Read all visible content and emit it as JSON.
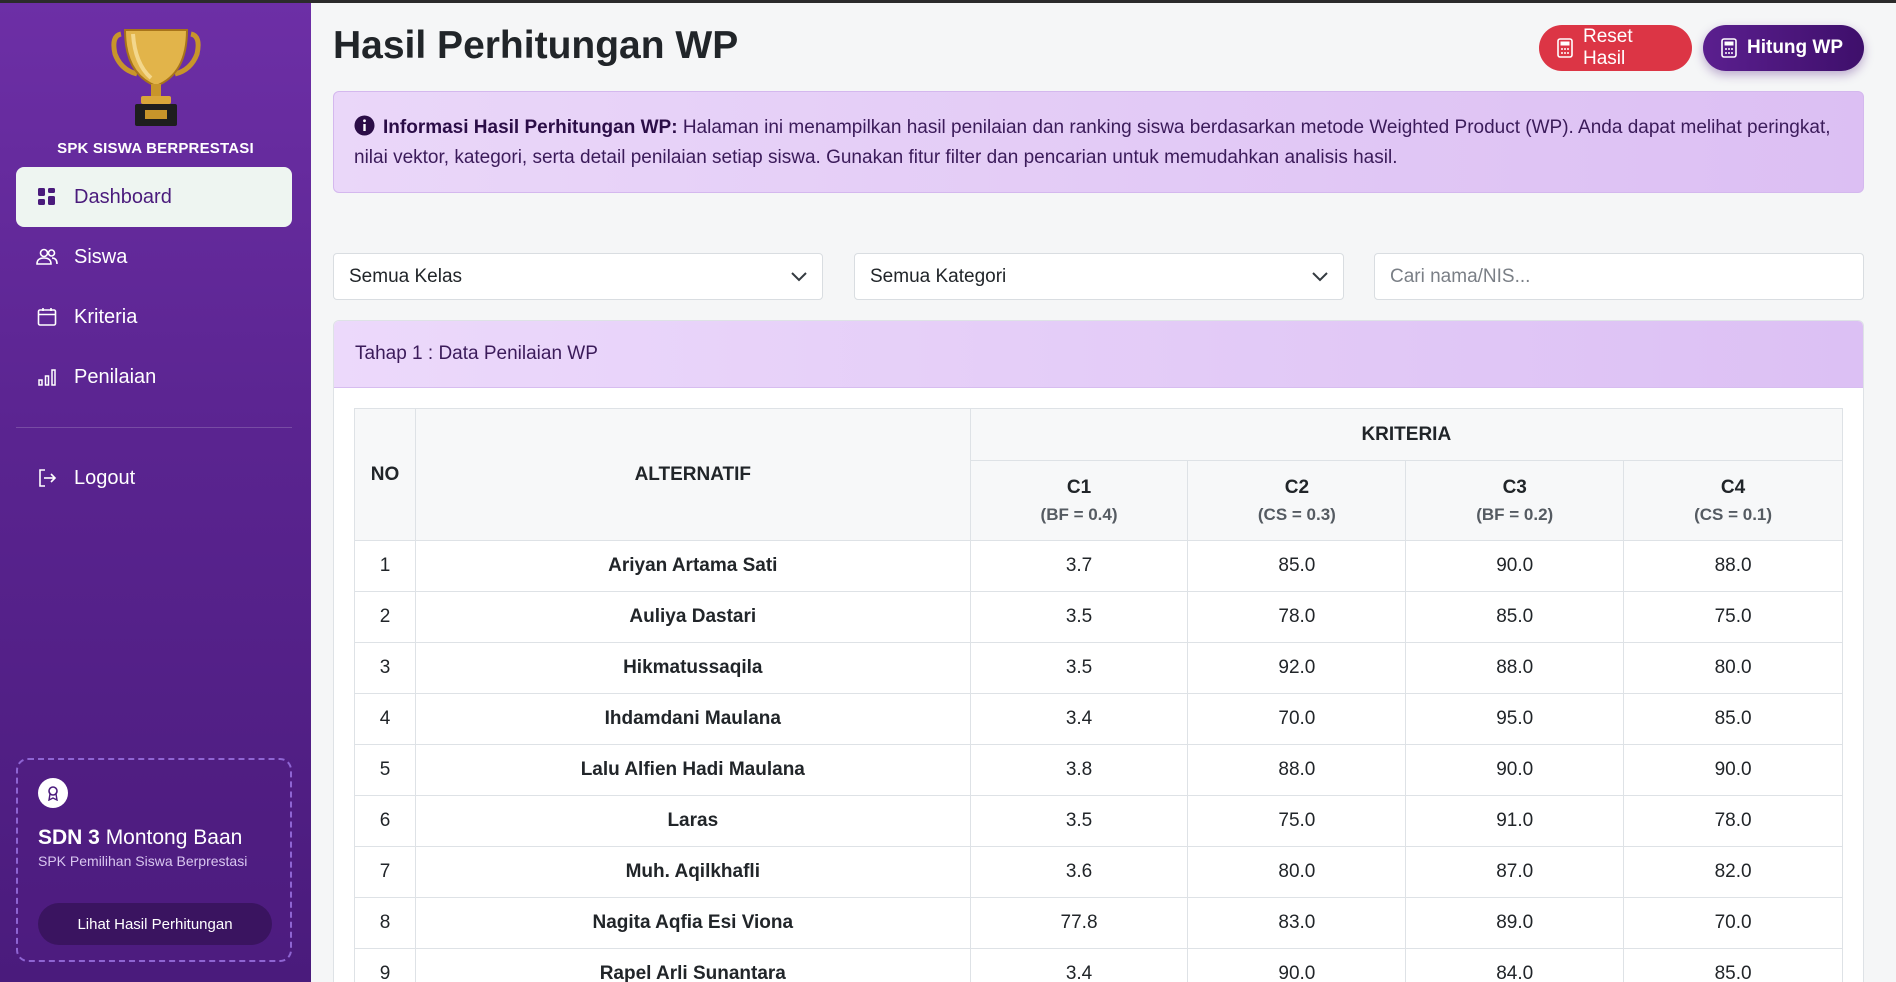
{
  "sidebar": {
    "brand": "SPK SISWA BERPRESTASI",
    "items": [
      {
        "label": "Dashboard",
        "icon": "dashboard-icon",
        "active": true
      },
      {
        "label": "Siswa",
        "icon": "users-icon"
      },
      {
        "label": "Kriteria",
        "icon": "calendar-icon"
      },
      {
        "label": "Penilaian",
        "icon": "chart-icon"
      }
    ],
    "logout": "Logout",
    "school": {
      "name_bold": "SDN 3",
      "name_rest": " Montong Baan",
      "subtitle": "SPK Pemilihan Siswa Berprestasi",
      "button": "Lihat Hasil Perhitungan"
    }
  },
  "header": {
    "title": "Hasil Perhitungan WP",
    "reset_label": "Reset Hasil",
    "hitung_label": "Hitung WP"
  },
  "info": {
    "heading": "Informasi Hasil Perhitungan WP:",
    "text": " Halaman ini menampilkan hasil penilaian dan ranking siswa berdasarkan metode Weighted Product (WP). Anda dapat melihat peringkat, nilai vektor, kategori, serta detail penilaian setiap siswa. Gunakan fitur filter dan pencarian untuk memudahkan analisis hasil."
  },
  "filters": {
    "kelas": "Semua Kelas",
    "kategori": "Semua Kategori",
    "search_placeholder": "Cari nama/NIS..."
  },
  "table": {
    "card_title": "Tahap 1 : Data Penilaian WP",
    "col_no": "NO",
    "col_alternatif": "ALTERNATIF",
    "col_kriteria": "KRITERIA",
    "criteria": [
      {
        "code": "C1",
        "sub": "(BF = 0.4)"
      },
      {
        "code": "C2",
        "sub": "(CS = 0.3)"
      },
      {
        "code": "C3",
        "sub": "(BF = 0.2)"
      },
      {
        "code": "C4",
        "sub": "(CS = 0.1)"
      }
    ],
    "rows": [
      [
        "1",
        "Ariyan Artama Sati",
        "3.7",
        "85.0",
        "90.0",
        "88.0"
      ],
      [
        "2",
        "Auliya Dastari",
        "3.5",
        "78.0",
        "85.0",
        "75.0"
      ],
      [
        "3",
        "Hikmatussaqila",
        "3.5",
        "92.0",
        "88.0",
        "80.0"
      ],
      [
        "4",
        "Ihdamdani Maulana",
        "3.4",
        "70.0",
        "95.0",
        "85.0"
      ],
      [
        "5",
        "Lalu Alfien Hadi Maulana",
        "3.8",
        "88.0",
        "90.0",
        "90.0"
      ],
      [
        "6",
        "Laras",
        "3.5",
        "75.0",
        "91.0",
        "78.0"
      ],
      [
        "7",
        "Muh. Aqilkhafli",
        "3.6",
        "80.0",
        "87.0",
        "82.0"
      ],
      [
        "8",
        "Nagita Aqfia Esi Viona",
        "77.8",
        "83.0",
        "89.0",
        "70.0"
      ],
      [
        "9",
        "Rapel Arli Sunantara",
        "3.4",
        "90.0",
        "84.0",
        "85.0"
      ]
    ]
  },
  "colors": {
    "sidebar": "#5a2490",
    "danger": "#dc3545",
    "primary": "#4a1b7c",
    "info_bg": "#e3cbf6"
  }
}
